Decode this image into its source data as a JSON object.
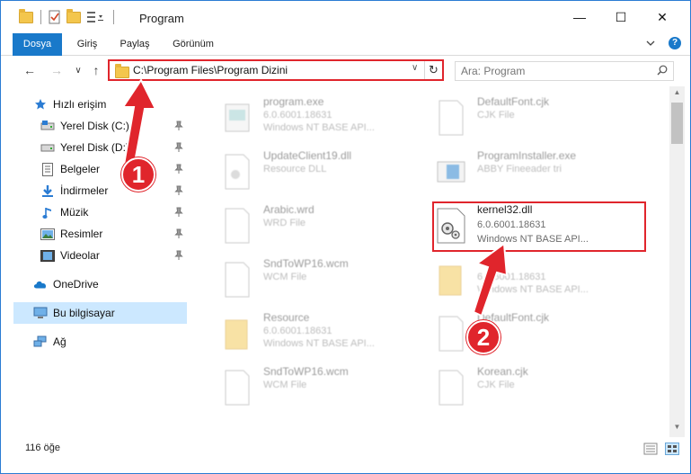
{
  "window": {
    "title": "Program",
    "minimize_glyph": "—",
    "maximize_glyph": "☐",
    "close_glyph": "✕"
  },
  "ribbon": {
    "tabs": [
      "Dosya",
      "Giriş",
      "Paylaş",
      "Görünüm"
    ],
    "help_glyph": "?"
  },
  "navigation": {
    "back_glyph": "←",
    "forward_glyph": "→",
    "recent_glyph": "∨",
    "up_glyph": "↑"
  },
  "address": {
    "path": "C:\\Program Files\\Program Dizini",
    "dropdown_glyph": "∨",
    "refresh_glyph": "↻"
  },
  "search": {
    "placeholder": "Ara: Program"
  },
  "sidebar": {
    "items": [
      {
        "label": "Hızlı erişim",
        "icon": "star-icon",
        "pinned": false
      },
      {
        "label": "Yerel Disk (C:)",
        "icon": "drive-icon",
        "pinned": true
      },
      {
        "label": "Yerel Disk (D:)",
        "icon": "drive-icon",
        "pinned": true
      },
      {
        "label": "Belgeler",
        "icon": "documents-icon",
        "pinned": true
      },
      {
        "label": "İndirmeler",
        "icon": "download-icon",
        "pinned": true
      },
      {
        "label": "Müzik",
        "icon": "music-icon",
        "pinned": true
      },
      {
        "label": "Resimler",
        "icon": "pictures-icon",
        "pinned": true
      },
      {
        "label": "Videolar",
        "icon": "videos-icon",
        "pinned": true
      },
      {
        "label": "OneDrive",
        "icon": "cloud-icon",
        "pinned": false
      },
      {
        "label": "Bu bilgisayar",
        "icon": "computer-icon",
        "pinned": false
      },
      {
        "label": "Ağ",
        "icon": "network-icon",
        "pinned": false
      }
    ],
    "selected": "Bu bilgisayar"
  },
  "files": [
    {
      "name": "program.exe",
      "line1": "6.0.6001.18631",
      "line2": "Windows NT BASE API...",
      "type": "exe"
    },
    {
      "name": "DefaultFont.cjk",
      "line1": "CJK File",
      "line2": "",
      "type": "doc"
    },
    {
      "name": "UpdateClient19.dll",
      "line1": "Resource DLL",
      "line2": "",
      "type": "doc"
    },
    {
      "name": "ProgramInstaller.exe",
      "line1": "ABBY Fineeader tri",
      "line2": "",
      "type": "app"
    },
    {
      "name": "Arabic.wrd",
      "line1": "WRD File",
      "line2": "",
      "type": "doc"
    },
    {
      "name": "kernel32.dll",
      "line1": "6.0.6001.18631",
      "line2": "Windows NT BASE API...",
      "type": "dll",
      "highlighted": true
    },
    {
      "name": "SndToWP16.wcm",
      "line1": "WCM File",
      "line2": "",
      "type": "doc"
    },
    {
      "name": "",
      "line1": "6.0.6001.18631",
      "line2": "Windows NT BASE API...",
      "type": "folder"
    },
    {
      "name": "Resource",
      "line1": "6.0.6001.18631",
      "line2": "Windows NT BASE API...",
      "type": "folder"
    },
    {
      "name": "DefaultFont.cjk",
      "line1": "",
      "line2": "",
      "type": "doc"
    },
    {
      "name": "SndToWP16.wcm",
      "line1": "WCM File",
      "line2": "",
      "type": "doc"
    },
    {
      "name": "Korean.cjk",
      "line1": "CJK File",
      "line2": "",
      "type": "doc"
    }
  ],
  "status": {
    "item_count": "116 öğe"
  },
  "callouts": [
    {
      "number": "1"
    },
    {
      "number": "2"
    }
  ],
  "colors": {
    "accent": "#1979ca",
    "highlight_red": "#e0252c",
    "selection": "#cce8ff",
    "folder": "#f3c64d"
  }
}
